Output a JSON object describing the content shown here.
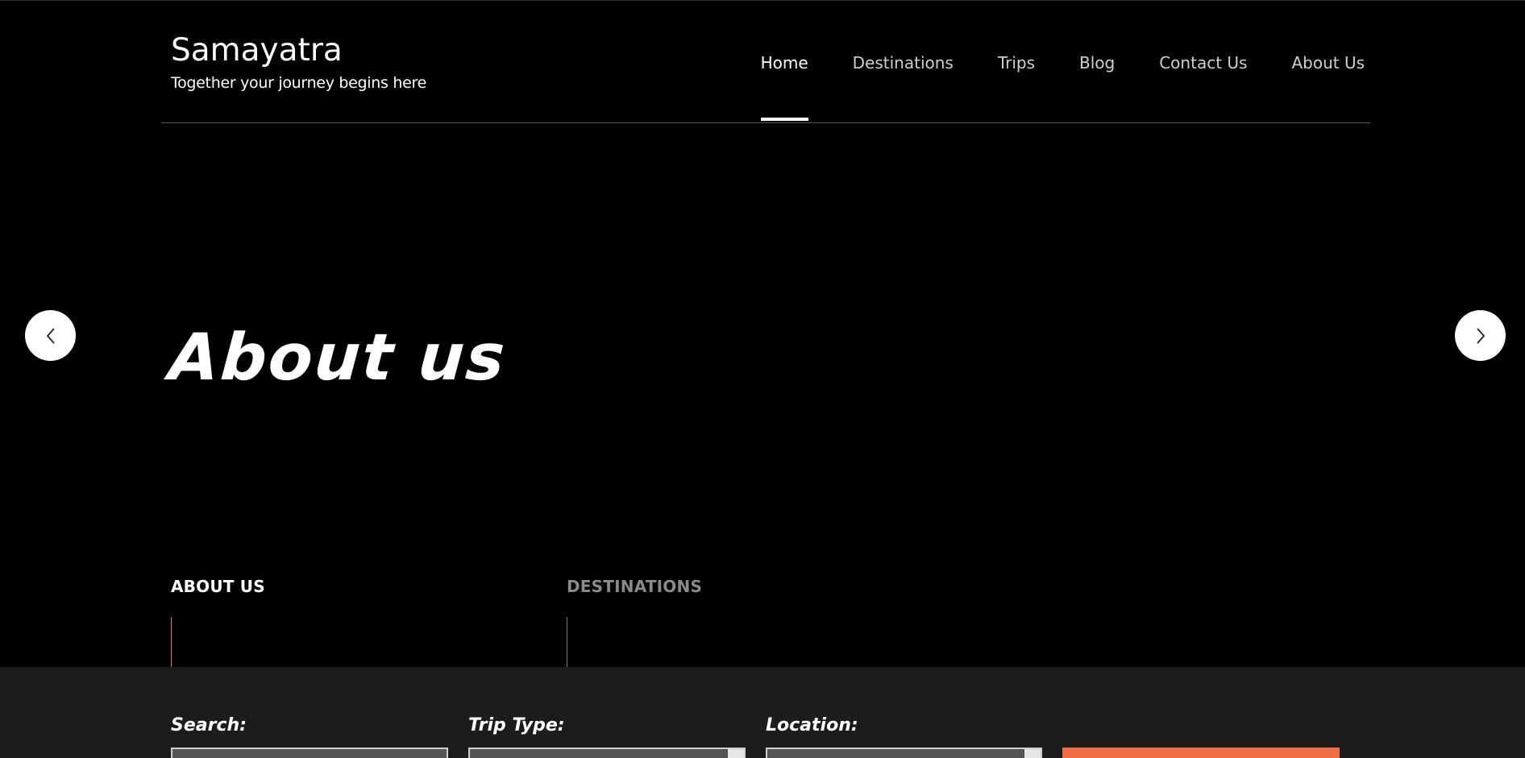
{
  "brand": {
    "title": "Samayatra",
    "tagline": "Together your journey begins here"
  },
  "nav": {
    "items": [
      {
        "label": "Home",
        "active": true
      },
      {
        "label": "Destinations",
        "active": false
      },
      {
        "label": "Trips",
        "active": false
      },
      {
        "label": "Blog",
        "active": false
      },
      {
        "label": "Contact Us",
        "active": false
      },
      {
        "label": "About Us",
        "active": false
      }
    ]
  },
  "hero": {
    "title": "About us",
    "prev_icon": "chevron-left-icon",
    "next_icon": "chevron-right-icon"
  },
  "tabs": {
    "about": "ABOUT US",
    "destinations": "DESTINATIONS"
  },
  "search": {
    "search_label": "Search:",
    "trip_type_label": "Trip Type:",
    "location_label": "Location:"
  },
  "colors": {
    "accent": "#ee6d44",
    "background": "#000000",
    "search_bar": "#1c1c1c"
  }
}
